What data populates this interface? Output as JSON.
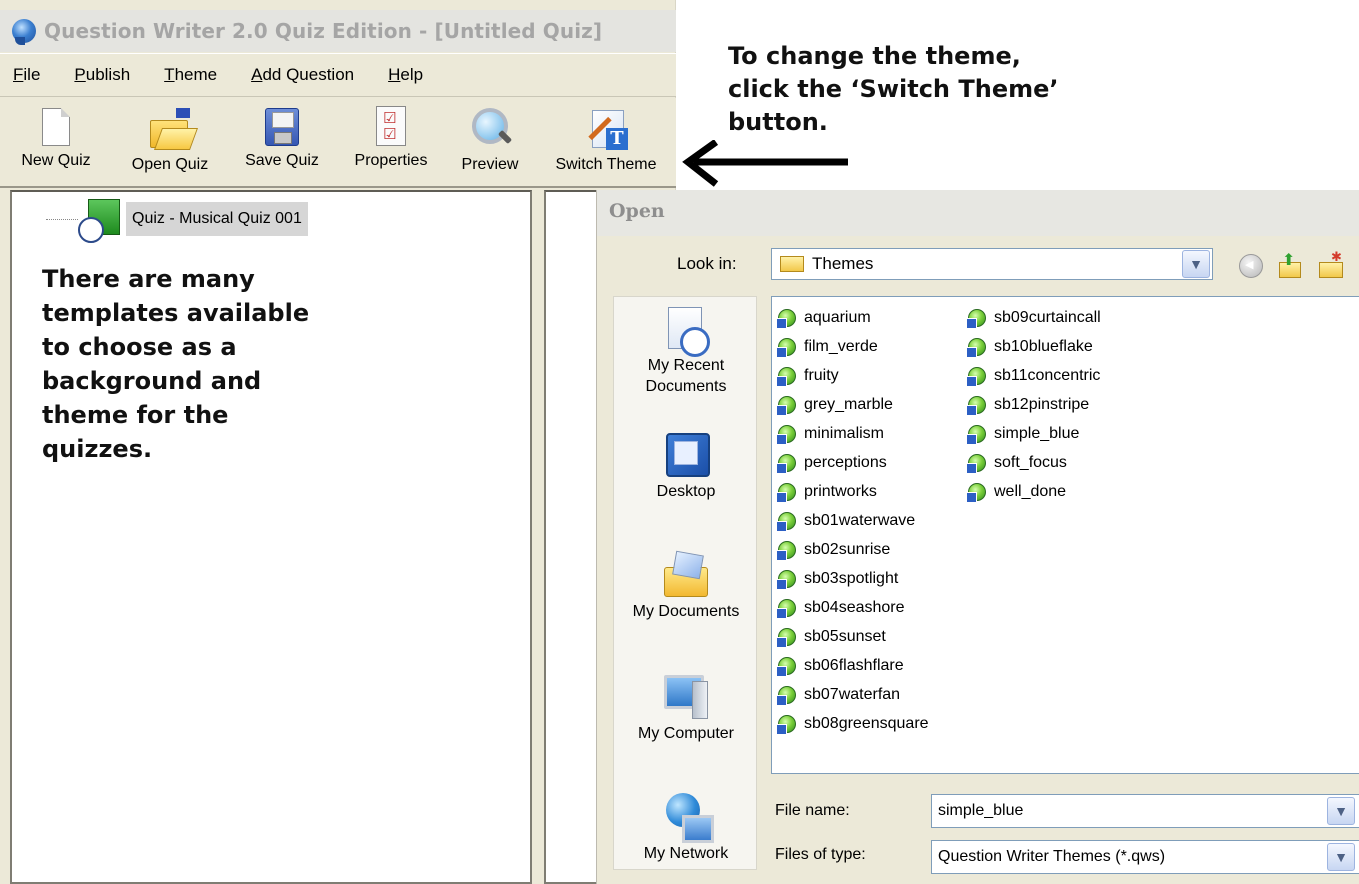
{
  "window": {
    "title": "Question Writer 2.0 Quiz Edition - [Untitled Quiz]"
  },
  "menu": {
    "items": [
      {
        "u": "F",
        "rest": "ile"
      },
      {
        "u": "P",
        "rest": "ublish"
      },
      {
        "u": "T",
        "rest": "heme"
      },
      {
        "u": "A",
        "rest": "dd Question"
      },
      {
        "u": "H",
        "rest": "elp"
      }
    ]
  },
  "toolbar": {
    "new_quiz": "New Quiz",
    "open_quiz": "Open Quiz",
    "save_quiz": "Save Quiz",
    "properties": "Properties",
    "preview": "Preview",
    "switch_theme": "Switch Theme"
  },
  "tree": {
    "node_label": "Quiz - Musical Quiz 001"
  },
  "annotations": {
    "left": [
      "There are many",
      "templates available",
      "to choose as a",
      "background and",
      "theme for the",
      "quizzes."
    ],
    "right": [
      "To change the theme,",
      "click the ‘Switch Theme’",
      "button."
    ]
  },
  "dialog": {
    "title": "Open",
    "look_in_label": "Look in:",
    "look_in_value": "Themes",
    "places": [
      "My Recent\nDocuments",
      "Desktop",
      "My Documents",
      "My Computer",
      "My Network"
    ],
    "files_col1": [
      "aquarium",
      "film_verde",
      "fruity",
      "grey_marble",
      "minimalism",
      "perceptions",
      "printworks",
      "sb01waterwave",
      "sb02sunrise",
      "sb03spotlight",
      "sb04seashore",
      "sb05sunset",
      "sb06flashflare",
      "sb07waterfan",
      "sb08greensquare"
    ],
    "files_col2": [
      "sb09curtaincall",
      "sb10blueflake",
      "sb11concentric",
      "sb12pinstripe",
      "simple_blue",
      "soft_focus",
      "well_done"
    ],
    "file_name_label": "File name:",
    "file_name_value": "simple_blue",
    "file_type_label": "Files of type:",
    "file_type_value": "Question Writer Themes (*.qws)"
  }
}
